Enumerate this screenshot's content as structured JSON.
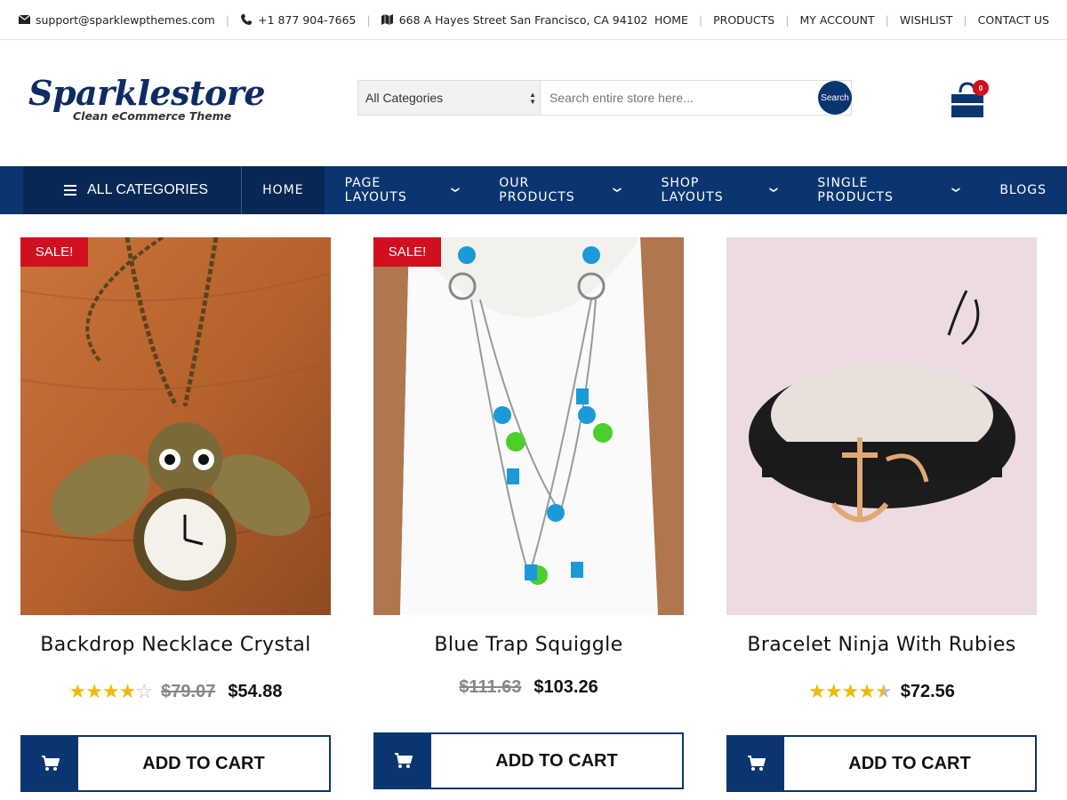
{
  "topbar": {
    "email": "support@sparklewpthemes.com",
    "phone": "+1 877 904-7665",
    "address": "668 A Hayes Street San Francisco, CA 94102",
    "links": [
      "HOME",
      "PRODUCTS",
      "MY ACCOUNT",
      "WISHLIST",
      "CONTACT US"
    ]
  },
  "header": {
    "logo_text": "Sparklestore",
    "logo_tagline": "Clean eCommerce Theme",
    "category_select": "All Categories",
    "search_placeholder": "Search entire store here...",
    "search_button": "Search",
    "cart_count": "0"
  },
  "nav": {
    "all_categories": "ALL CATEGORIES",
    "items": [
      {
        "label": "HOME",
        "active": true,
        "dropdown": false
      },
      {
        "label": "PAGE LAYOUTS",
        "active": false,
        "dropdown": true
      },
      {
        "label": "OUR PRODUCTS",
        "active": false,
        "dropdown": true
      },
      {
        "label": "SHOP LAYOUTS",
        "active": false,
        "dropdown": true
      },
      {
        "label": "SINGLE PRODUCTS",
        "active": false,
        "dropdown": true
      },
      {
        "label": "BLOGS",
        "active": false,
        "dropdown": false
      }
    ]
  },
  "products": [
    {
      "name": "Backdrop Necklace Crystal",
      "sale_badge": "SALE!",
      "rating": 4,
      "old_price": "$79.07",
      "price": "$54.88",
      "cta": "ADD TO CART"
    },
    {
      "name": "Blue Trap Squiggle",
      "sale_badge": "SALE!",
      "old_price": "$111.63",
      "price": "$103.26",
      "cta": "ADD TO CART"
    },
    {
      "name": "Bracelet Ninja With Rubies",
      "rating": 4.5,
      "price": "$72.56",
      "cta": "ADD TO CART"
    }
  ],
  "colors": {
    "navy": "#0b3570",
    "navy_dark": "#082755",
    "sale_red": "#d0101e",
    "star": "#f5b800"
  }
}
